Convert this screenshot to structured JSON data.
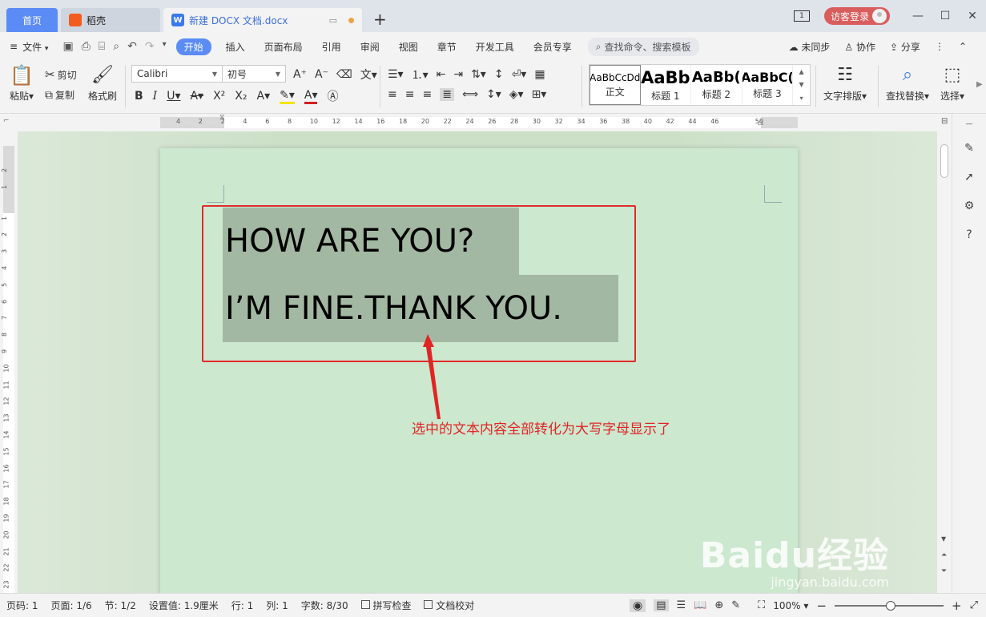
{
  "tabs": {
    "home": "首页",
    "daoke": "稻壳",
    "doc": "新建 DOCX 文档.docx",
    "new_tab_symbol": "+"
  },
  "titlebar_right": {
    "page_badge": "1",
    "login_label": "访客登录"
  },
  "menu": {
    "file": "文件",
    "items": [
      "开始",
      "插入",
      "页面布局",
      "引用",
      "审阅",
      "视图",
      "章节",
      "开发工具",
      "会员专享"
    ],
    "active": "开始",
    "search_placeholder": "查找命令、搜索模板",
    "right": [
      "未同步",
      "协作",
      "分享"
    ]
  },
  "ribbon": {
    "paste": "粘贴",
    "cut": "剪切",
    "copy": "复制",
    "format_painter": "格式刷",
    "font_name": "Calibri",
    "font_size": "初号",
    "styles": [
      {
        "sample": "AaBbCcDd",
        "label": "正文"
      },
      {
        "sample": "AaBb",
        "label": "标题 1"
      },
      {
        "sample": "AaBb(",
        "label": "标题 2"
      },
      {
        "sample": "AaBbC(",
        "label": "标题 3"
      }
    ],
    "text_layout": "文字排版",
    "find_replace": "查找替换",
    "select": "选择"
  },
  "ruler": {
    "h_ticks": [
      "4",
      "2",
      "2",
      "4",
      "6",
      "8",
      "10",
      "12",
      "14",
      "16",
      "18",
      "20",
      "22",
      "24",
      "26",
      "28",
      "30",
      "32",
      "34",
      "36",
      "38",
      "40",
      "42",
      "44",
      "46",
      "50"
    ],
    "v_ticks": [
      "2",
      "1",
      "1",
      "2",
      "3",
      "4",
      "5",
      "6",
      "7",
      "8",
      "9",
      "10",
      "11",
      "12",
      "13",
      "14",
      "15",
      "16",
      "17",
      "18",
      "19",
      "20",
      "21",
      "22",
      "23"
    ]
  },
  "document": {
    "line1": "HOW ARE YOU?",
    "line2": "I’M FINE.THANK YOU.",
    "annotation": "选中的文本内容全部转化为大写字母显示了"
  },
  "watermark": {
    "brand": "Baidu经验",
    "url": "jingyan.baidu.com"
  },
  "status": {
    "page_num": "页码: 1",
    "pages": "页面: 1/6",
    "section": "节: 1/2",
    "setting": "设置值: 1.9厘米",
    "row": "行: 1",
    "col": "列: 1",
    "word_count": "字数: 8/30",
    "spell_check": "拼写检查",
    "doc_proof": "文档校对",
    "zoom": "100%",
    "zoom_minus": "−",
    "zoom_plus": "+"
  },
  "colors": {
    "accent": "#5b8cf5",
    "selection": "#a3b8a2",
    "page_bg": "#cce8cf",
    "annotation_red": "#e02525",
    "login_btn": "#d95d5d"
  }
}
